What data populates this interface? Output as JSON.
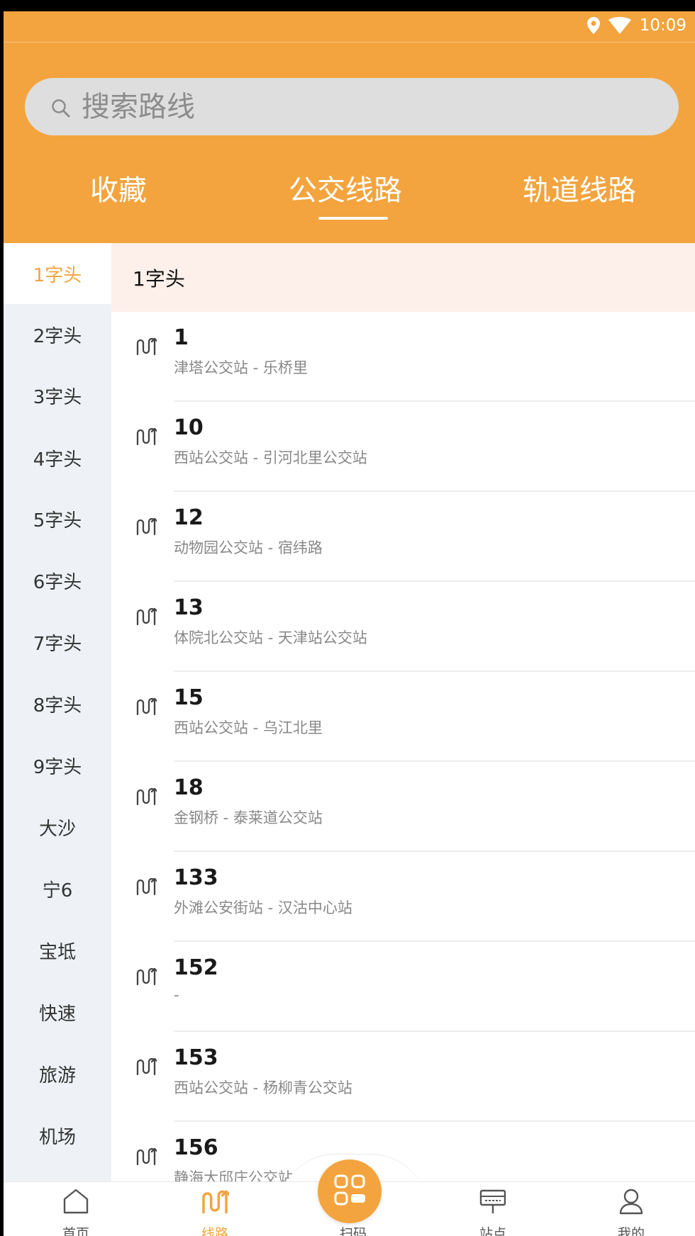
{
  "status_bar": {
    "time": "10:09",
    "icons": [
      "location-icon",
      "wifi-icon"
    ]
  },
  "search": {
    "placeholder": "搜索路线",
    "icon": "search-icon"
  },
  "tabs": [
    {
      "label": "收藏",
      "active": false
    },
    {
      "label": "公交线路",
      "active": true
    },
    {
      "label": "轨道线路",
      "active": false
    }
  ],
  "sidebar": {
    "items": [
      "1字头",
      "2字头",
      "3字头",
      "4字头",
      "5字头",
      "6字头",
      "7字头",
      "8字头",
      "9字头",
      "大沙",
      "宁6",
      "宝坻",
      "快速",
      "旅游",
      "机场"
    ],
    "active_index": 0
  },
  "section": {
    "title": "1字头"
  },
  "routes": [
    {
      "number": "1",
      "desc": "津塔公交站 - 乐桥里"
    },
    {
      "number": "10",
      "desc": "西站公交站 - 引河北里公交站"
    },
    {
      "number": "12",
      "desc": "动物园公交站 - 宿纬路"
    },
    {
      "number": "13",
      "desc": "体院北公交站 - 天津站公交站"
    },
    {
      "number": "15",
      "desc": "西站公交站 - 乌江北里"
    },
    {
      "number": "18",
      "desc": "金钢桥 - 泰莱道公交站"
    },
    {
      "number": "133",
      "desc": "外滩公安街站 - 汉沽中心站"
    },
    {
      "number": "152",
      "desc": "-"
    },
    {
      "number": "153",
      "desc": "西站公交站 - 杨柳青公交站"
    },
    {
      "number": "156",
      "desc": "静海大邱庄公交站"
    }
  ],
  "bottom_nav": {
    "items": [
      {
        "label": "首页",
        "icon": "home-icon",
        "active": false
      },
      {
        "label": "线路",
        "icon": "route-icon",
        "active": true
      },
      {
        "label": "扫码",
        "icon": "scan-icon",
        "active": false
      },
      {
        "label": "站点",
        "icon": "bus-stop-icon",
        "active": false
      },
      {
        "label": "我的",
        "icon": "profile-icon",
        "active": false
      }
    ]
  },
  "colors": {
    "accent": "#F3A43E",
    "sidebar_bg": "#EEF2F6",
    "section_bg": "#FDF0EB"
  }
}
